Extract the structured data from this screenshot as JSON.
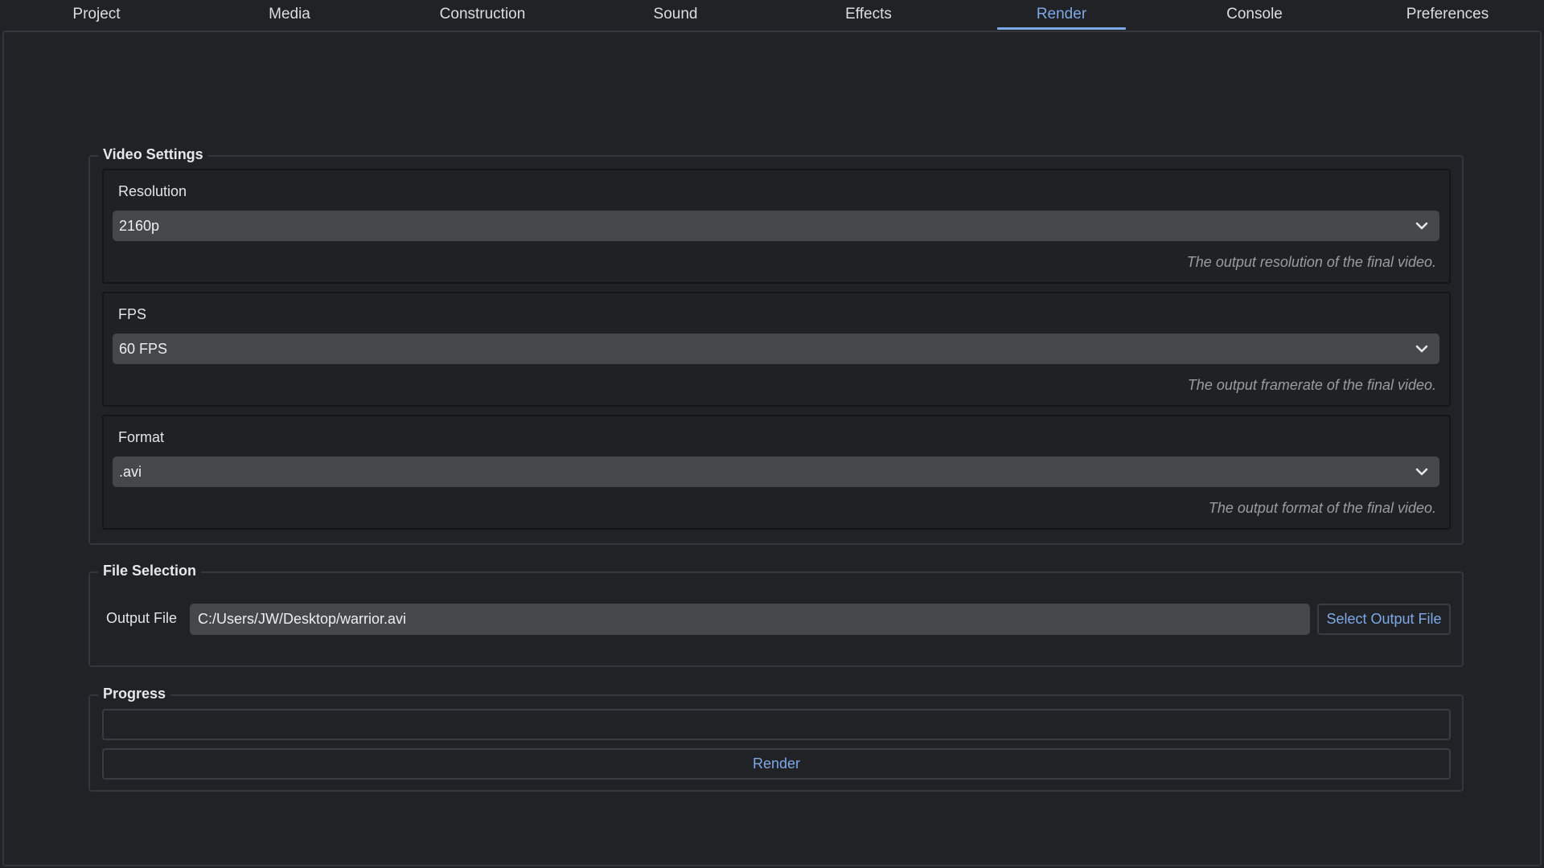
{
  "tabs": [
    {
      "label": "Project"
    },
    {
      "label": "Media"
    },
    {
      "label": "Construction"
    },
    {
      "label": "Sound"
    },
    {
      "label": "Effects"
    },
    {
      "label": "Render",
      "active": true
    },
    {
      "label": "Console"
    },
    {
      "label": "Preferences"
    }
  ],
  "video_settings": {
    "title": "Video Settings",
    "resolution": {
      "label": "Resolution",
      "value": "2160p",
      "description": "The output resolution of the final video."
    },
    "fps": {
      "label": "FPS",
      "value": "60 FPS",
      "description": "The output framerate of the final video."
    },
    "format": {
      "label": "Format",
      "value": ".avi",
      "description": "The output format of the final video."
    }
  },
  "file_selection": {
    "title": "File Selection",
    "output_label": "Output File",
    "output_value": "C:/Users/JW/Desktop/warrior.avi",
    "select_button": "Select Output File"
  },
  "progress": {
    "title": "Progress",
    "value": 0,
    "render_button": "Render"
  },
  "colors": {
    "accent": "#7ea8e6",
    "background": "#202226",
    "field": "#45474b"
  },
  "icons": {
    "dropdown": "chevron-down-icon"
  }
}
